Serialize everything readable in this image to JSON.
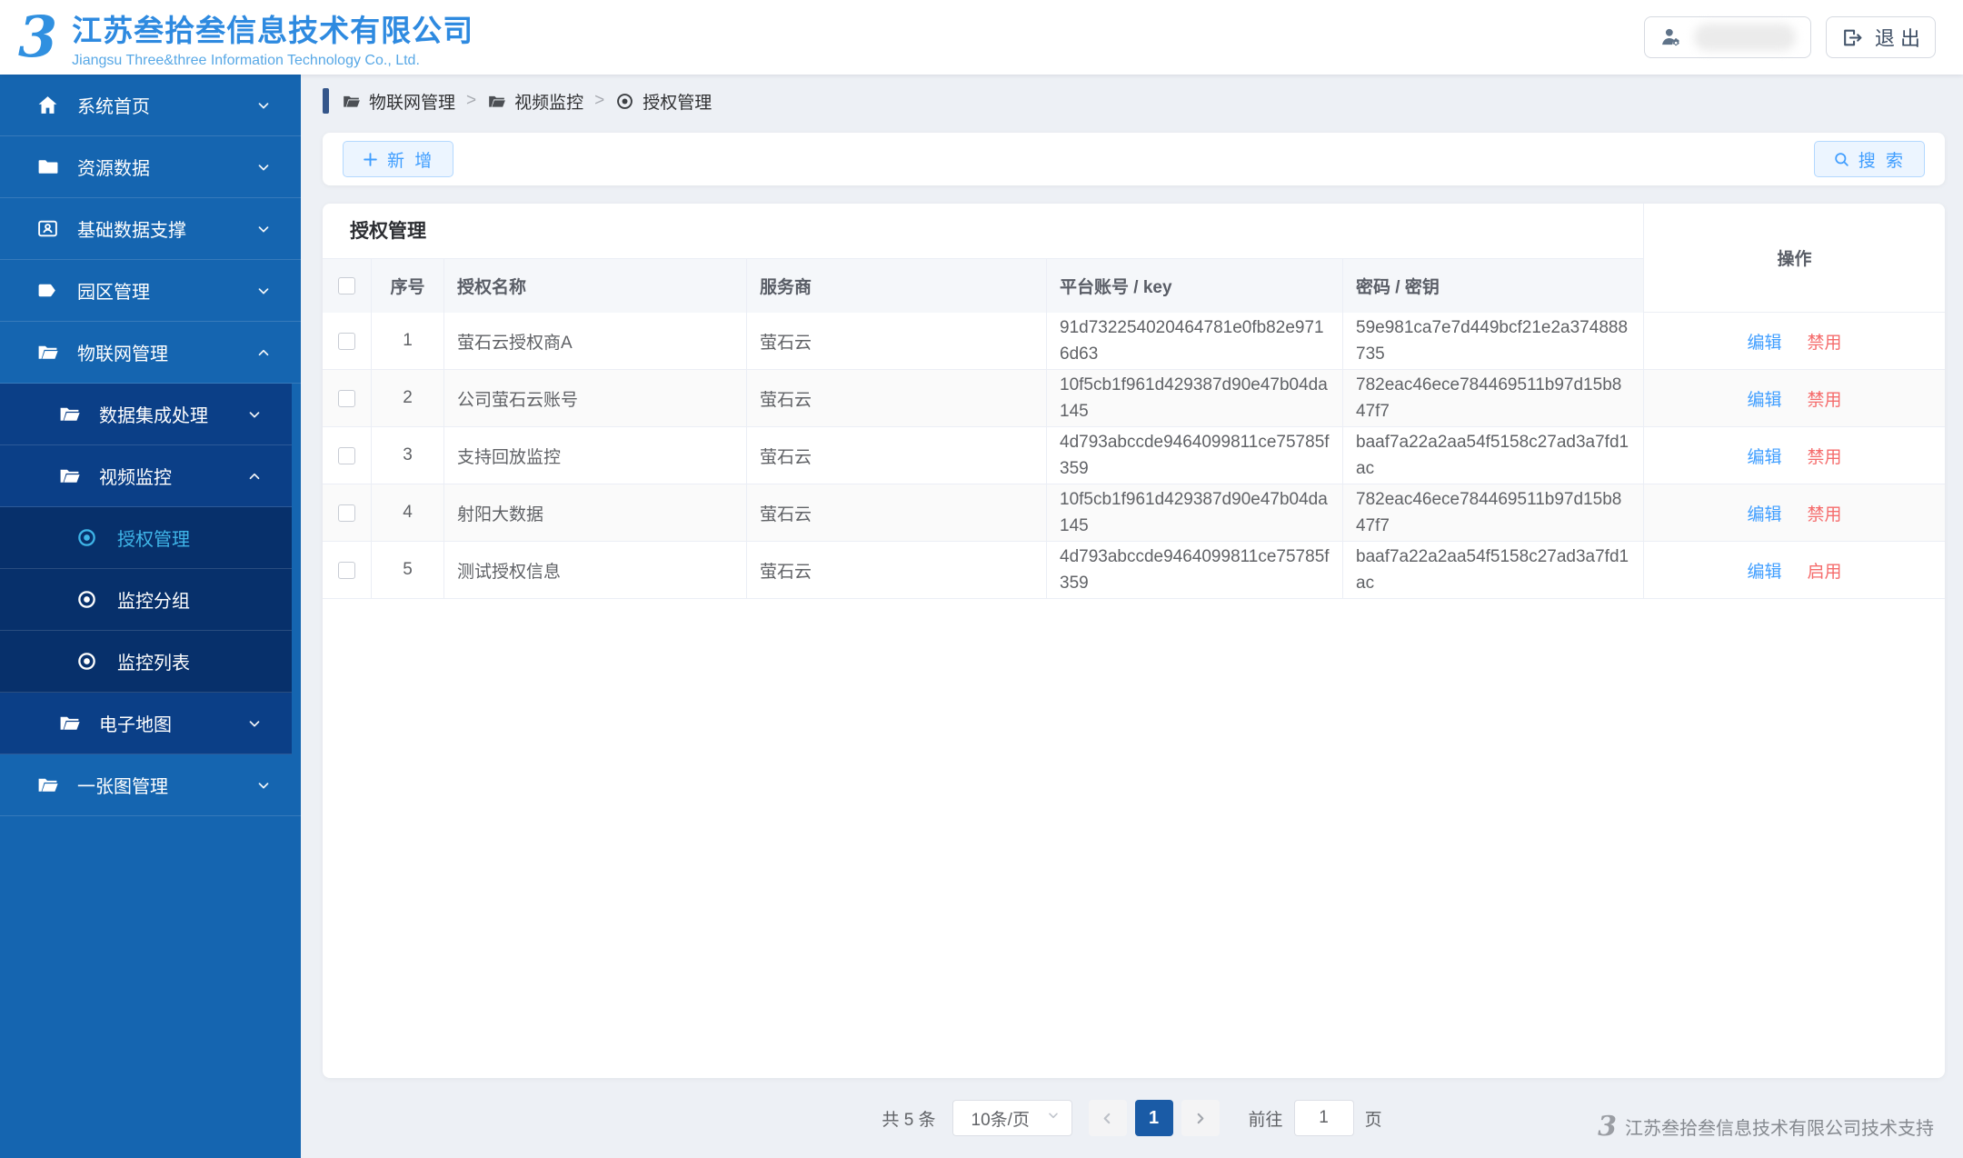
{
  "colors": {
    "accent": "#409eff",
    "danger": "#f56c6c",
    "sidebar_level1_bg": "#1565b0",
    "sidebar_level2_bg": "#0b3f87",
    "sidebar_level3_bg": "#07306b",
    "sidebar_active_text": "#3fb5e8",
    "page_active_bg": "#1a5ba6",
    "logo_blue": "#2e8ae0"
  },
  "header": {
    "logo_mark": "3",
    "company_cn": "江苏叁拾叁信息技术有限公司",
    "company_en": "Jiangsu Three&three Information Technology Co., Ltd.",
    "logout_label": "退 出"
  },
  "sidebar": {
    "items": [
      {
        "label": "系统首页",
        "level": 1,
        "icon": "home-icon",
        "chevron": "down",
        "active": false
      },
      {
        "label": "资源数据",
        "level": 1,
        "icon": "folder-icon",
        "chevron": "down",
        "active": false
      },
      {
        "label": "基础数据支撑",
        "level": 1,
        "icon": "idcard-icon",
        "chevron": "down",
        "active": false
      },
      {
        "label": "园区管理",
        "level": 1,
        "icon": "tag-icon",
        "chevron": "down",
        "active": false
      },
      {
        "label": "物联网管理",
        "level": 1,
        "icon": "folder-open-icon",
        "chevron": "up",
        "active": false
      },
      {
        "label": "数据集成处理",
        "level": 2,
        "icon": "folder-open-icon",
        "chevron": "down",
        "active": false
      },
      {
        "label": "视频监控",
        "level": 2,
        "icon": "folder-open-icon",
        "chevron": "up",
        "active": false
      },
      {
        "label": "授权管理",
        "level": 3,
        "icon": "target-icon",
        "chevron": null,
        "active": true
      },
      {
        "label": "监控分组",
        "level": 3,
        "icon": "target-icon",
        "chevron": null,
        "active": false
      },
      {
        "label": "监控列表",
        "level": 3,
        "icon": "target-icon",
        "chevron": null,
        "active": false
      },
      {
        "label": "电子地图",
        "level": 2,
        "icon": "folder-open-icon",
        "chevron": "down",
        "active": false
      },
      {
        "label": "一张图管理",
        "level": 1,
        "icon": "folder-open-icon",
        "chevron": "down",
        "active": false
      }
    ]
  },
  "breadcrumb": {
    "separator": ">",
    "items": [
      {
        "label": "物联网管理",
        "icon": "folder-icon"
      },
      {
        "label": "视频监控",
        "icon": "folder-icon"
      },
      {
        "label": "授权管理",
        "icon": "target-icon"
      }
    ]
  },
  "toolbar": {
    "add_label": "新 增",
    "search_label": "搜 索"
  },
  "table": {
    "title": "授权管理",
    "columns": {
      "index": "序号",
      "name": "授权名称",
      "provider": "服务商",
      "key": "平台账号 / key",
      "secret": "密码 / 密钥",
      "actions": "操作"
    },
    "rows": [
      {
        "index": "1",
        "name": "萤石云授权商A",
        "provider": "萤石云",
        "key": "91d732254020464781e0fb82e9716d63",
        "secret": "59e981ca7e7d449bcf21e2a374888735",
        "actions": [
          {
            "label": "编辑",
            "type": "primary"
          },
          {
            "label": "禁用",
            "type": "danger"
          }
        ]
      },
      {
        "index": "2",
        "name": "公司萤石云账号",
        "provider": "萤石云",
        "key": "10f5cb1f961d429387d90e47b04da145",
        "secret": "782eac46ece784469511b97d15b847f7",
        "actions": [
          {
            "label": "编辑",
            "type": "primary"
          },
          {
            "label": "禁用",
            "type": "danger"
          }
        ]
      },
      {
        "index": "3",
        "name": "支持回放监控",
        "provider": "萤石云",
        "key": "4d793abccde9464099811ce75785f359",
        "secret": "baaf7a22a2aa54f5158c27ad3a7fd1ac",
        "actions": [
          {
            "label": "编辑",
            "type": "primary"
          },
          {
            "label": "禁用",
            "type": "danger"
          }
        ]
      },
      {
        "index": "4",
        "name": "射阳大数据",
        "provider": "萤石云",
        "key": "10f5cb1f961d429387d90e47b04da145",
        "secret": "782eac46ece784469511b97d15b847f7",
        "actions": [
          {
            "label": "编辑",
            "type": "primary"
          },
          {
            "label": "禁用",
            "type": "danger"
          }
        ]
      },
      {
        "index": "5",
        "name": "测试授权信息",
        "provider": "萤石云",
        "key": "4d793abccde9464099811ce75785f359",
        "secret": "baaf7a22a2aa54f5158c27ad3a7fd1ac",
        "actions": [
          {
            "label": "编辑",
            "type": "primary"
          },
          {
            "label": "启用",
            "type": "danger"
          }
        ]
      }
    ]
  },
  "pagination": {
    "total": "共 5 条",
    "page_size": "10条/页",
    "current_page": "1",
    "goto_label": "前往",
    "goto_value": "1",
    "page_unit": "页"
  },
  "footer": {
    "logo_mark": "3",
    "support_text": "江苏叁拾叁信息技术有限公司技术支持"
  }
}
